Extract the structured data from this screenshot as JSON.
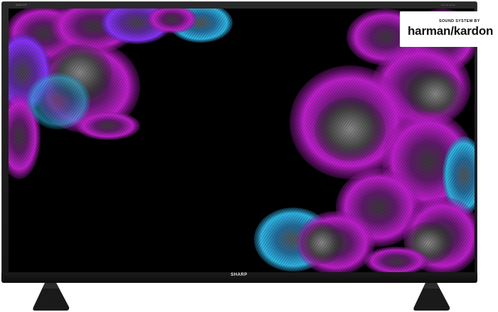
{
  "tv": {
    "brand_logo": "SHARP",
    "series_logo": "AQUOS",
    "top_right_text": "harman kardon",
    "colors": {
      "bezel": "#1c1c1c",
      "screen": "#000000",
      "feather_magenta": "#c21fd0",
      "feather_violet": "#7a2cff",
      "feather_cyan": "#2fb8e6",
      "feather_grey": "#6b6b6b"
    }
  },
  "badge": {
    "small_text": "SOUND SYSTEM BY",
    "brand_text": "harman/kardon"
  }
}
